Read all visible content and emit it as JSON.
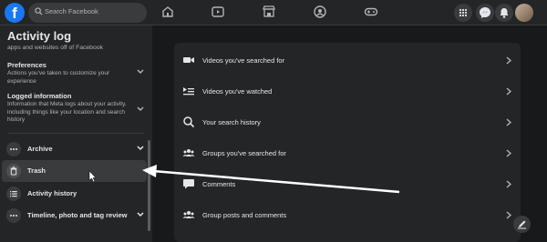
{
  "header": {
    "logo_letter": "f",
    "search_placeholder": "Search Facebook"
  },
  "sidebar": {
    "title": "Activity log",
    "subtitle": "apps and websites off of Facebook",
    "sections": [
      {
        "heading": "Preferences",
        "description": "Actions you've taken to customize your experience"
      },
      {
        "heading": "Logged information",
        "description": "Information that Meta logs about your activity, including things like your location and search history"
      }
    ],
    "items": [
      {
        "label": "Archive",
        "icon": "more-icon",
        "has_chevron": true
      },
      {
        "label": "Trash",
        "icon": "trash-icon",
        "active": true
      },
      {
        "label": "Activity history",
        "icon": "list-icon"
      },
      {
        "label": "Timeline, photo and tag review",
        "icon": "more-icon",
        "has_chevron": true
      }
    ]
  },
  "main": {
    "items": [
      {
        "label": "Videos you've searched for",
        "icon": "video-camera-icon"
      },
      {
        "label": "Videos you've watched",
        "icon": "video-list-icon"
      },
      {
        "label": "Your search history",
        "icon": "search-icon"
      },
      {
        "label": "Groups you've searched for",
        "icon": "groups-icon"
      },
      {
        "label": "Comments",
        "icon": "comment-icon"
      },
      {
        "label": "Group posts and comments",
        "icon": "groups-icon"
      }
    ]
  },
  "colors": {
    "brand": "#1877f2",
    "background": "#18191a",
    "surface": "#242526",
    "hover": "#3a3b3c"
  }
}
